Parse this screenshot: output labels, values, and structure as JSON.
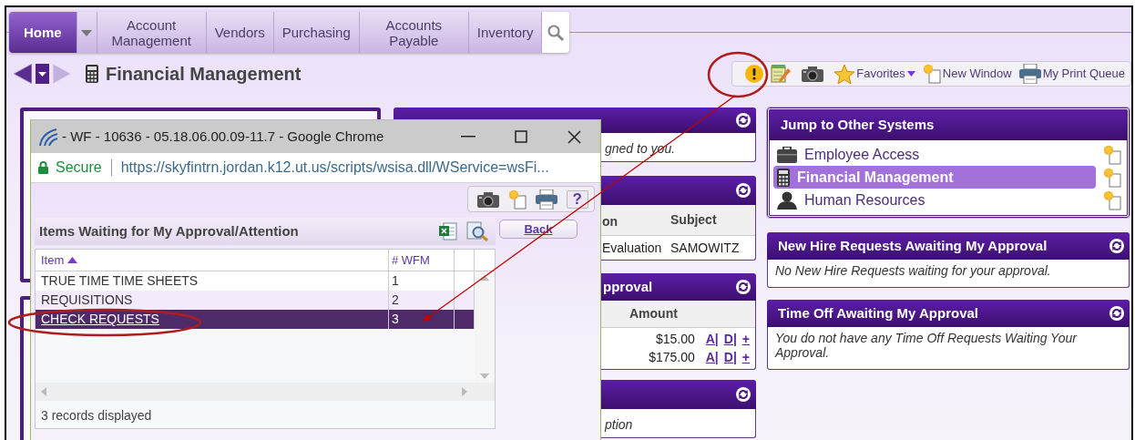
{
  "nav": {
    "tabs": [
      {
        "label": "Home",
        "selected": true
      },
      {
        "label": "Account Management",
        "selected": false
      },
      {
        "label": "Vendors",
        "selected": false
      },
      {
        "label": "Purchasing",
        "selected": false
      },
      {
        "label": "Accounts Payable",
        "selected": false
      },
      {
        "label": "Inventory",
        "selected": false
      }
    ]
  },
  "page_title": "Financial Management",
  "toolbar": [
    {
      "kind": "alert"
    },
    {
      "kind": "notes"
    },
    {
      "kind": "camera"
    },
    {
      "kind": "favorites",
      "label": "Favorites"
    },
    {
      "kind": "new_window",
      "label": "New Window"
    },
    {
      "kind": "print",
      "label": "My Print Queue"
    }
  ],
  "middle_panels": [
    {
      "kind": "message",
      "message": "gned to you."
    },
    {
      "kind": "table",
      "columns": [
        "on",
        "Subject"
      ],
      "rows": [
        [
          "Evaluation",
          "SAMOWITZ"
        ]
      ]
    },
    {
      "kind": "amounts",
      "title": "pproval",
      "title_partial": true,
      "columns": [
        "Amount"
      ],
      "rows": [
        {
          "amount": "$15.00",
          "actions": [
            "A|",
            "D|",
            "+"
          ]
        },
        {
          "amount": "$175.00",
          "actions": [
            "A|",
            "D|",
            "+"
          ]
        }
      ]
    },
    {
      "kind": "message",
      "message": "ption"
    }
  ],
  "jump": {
    "title": "Jump to Other Systems",
    "items": [
      {
        "kind": "employee",
        "label": "Employee Access",
        "selected": false
      },
      {
        "kind": "finance",
        "label": "Financial Management",
        "selected": true
      },
      {
        "kind": "hr",
        "label": "Human Resources",
        "selected": false
      }
    ]
  },
  "right_panels": [
    {
      "title": "New Hire Requests Awaiting My Approval",
      "message": "No New Hire Requests waiting for your approval."
    },
    {
      "title": "Time Off Awaiting My Approval",
      "message": "You do not have any Time Off Requests Waiting Your Approval."
    }
  ],
  "popup": {
    "title": "- WF - 10636 - 05.18.06.00.09-11.7 - Google Chrome",
    "secure": "Secure",
    "url": "https://skyfintrn.jordan.k12.ut.us/scripts/wsisa.dll/WService=wsFi...",
    "help": "?",
    "panel_title": "Items Waiting for My Approval/Attention",
    "back": "Back",
    "columns": [
      "Item",
      "# WFM"
    ],
    "rows": [
      {
        "item": "TRUE TIME TIME SHEETS",
        "count": "1",
        "selected": false
      },
      {
        "item": "REQUISITIONS",
        "count": "2",
        "selected": false
      },
      {
        "item": "CHECK REQUESTS",
        "count": "3",
        "selected": true
      }
    ],
    "footer": "3 records displayed"
  }
}
